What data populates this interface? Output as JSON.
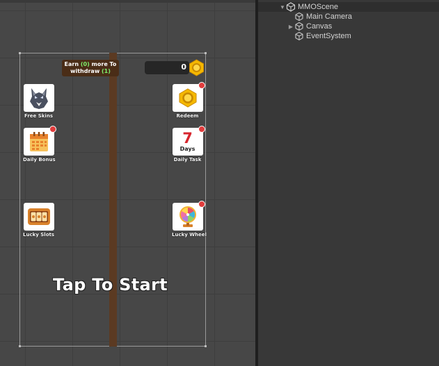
{
  "scene_view": {
    "earn_prefix": "Earn",
    "earn_amount": "(0)",
    "earn_middle": "more To",
    "earn_withdraw": "withdraw",
    "earn_count": "(1)",
    "coin_count": "0",
    "tap_to_start": "Tap To Start",
    "buttons": {
      "free_skins": "Free Skins",
      "redeem": "Redeem",
      "daily_bonus": "Daily Bonus",
      "daily_task": "Daily Task",
      "daily_task_number": "7",
      "daily_task_days": "Days",
      "lucky_slots": "Lucky Slots",
      "lucky_wheel": "Lucky Wheel"
    }
  },
  "hierarchy": {
    "scene_name": "MMOScene",
    "items": [
      {
        "label": "Main Camera",
        "expandable": false
      },
      {
        "label": "Canvas",
        "expandable": true
      },
      {
        "label": "EventSystem",
        "expandable": false
      }
    ]
  },
  "colors": {
    "coin": "#f5b800",
    "badge": "#e13c3c",
    "trunk": "#5b3a22",
    "earn_highlight": "#7ef16c"
  },
  "icons": [
    "unity-scene-icon",
    "gameobject-cube-icon",
    "coin-icon",
    "wolf-icon",
    "calendar-icon",
    "slot-machine-icon",
    "prize-wheel-icon",
    "expand-arrow-icon"
  ]
}
